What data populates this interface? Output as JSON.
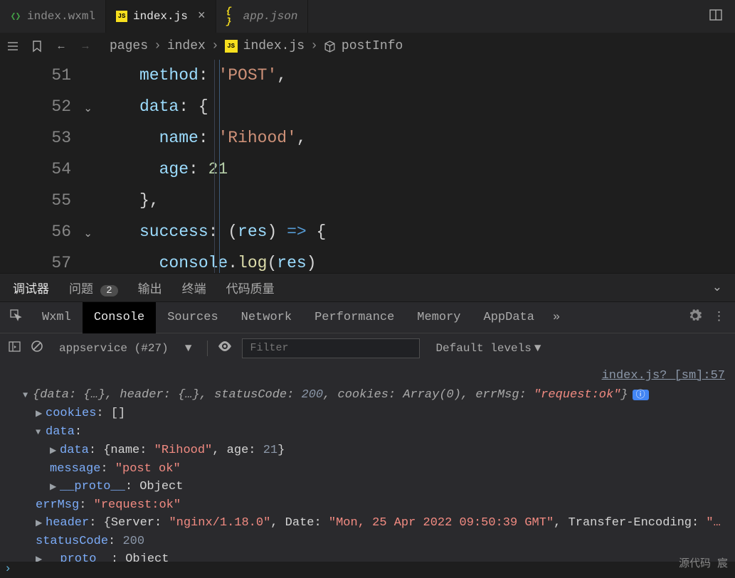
{
  "tabs": [
    {
      "label": "index.wxml",
      "type": "wxml"
    },
    {
      "label": "index.js",
      "type": "js",
      "active": true
    },
    {
      "label": "app.json",
      "type": "json"
    }
  ],
  "breadcrumb": {
    "p1": "pages",
    "p2": "index",
    "p3": "index.js",
    "p4": "postInfo"
  },
  "editor": {
    "lines": [
      {
        "n": "51",
        "t": [
          "method",
          ": ",
          "'POST'",
          ","
        ],
        "cls": [
          "prop",
          "punc",
          "str",
          "punc"
        ]
      },
      {
        "n": "52",
        "t": [
          "data",
          ": ",
          "{"
        ],
        "cls": [
          "prop",
          "punc",
          "punc"
        ],
        "fold": true
      },
      {
        "n": "53",
        "t": [
          "  name",
          ": ",
          "'Rihood'",
          ","
        ],
        "cls": [
          "prop",
          "punc",
          "str",
          "punc"
        ]
      },
      {
        "n": "54",
        "t": [
          "  age",
          ": ",
          "21"
        ],
        "cls": [
          "prop",
          "punc",
          "num"
        ]
      },
      {
        "n": "55",
        "t": [
          "}",
          ","
        ],
        "cls": [
          "punc",
          "punc"
        ]
      },
      {
        "n": "56",
        "t": [
          "success",
          ": ",
          "(",
          "res",
          ")",
          " => ",
          "{"
        ],
        "cls": [
          "prop",
          "punc",
          "punc",
          "var",
          "punc",
          "kw",
          "punc"
        ],
        "fold": true
      },
      {
        "n": "57",
        "t": [
          "  console",
          ".",
          "log",
          "(",
          "res",
          ")"
        ],
        "cls": [
          "var",
          "punc",
          "fn",
          "punc",
          "var",
          "punc"
        ]
      }
    ]
  },
  "panelTabs": {
    "debugger": "调试器",
    "problems": "问题",
    "problemsCount": "2",
    "output": "输出",
    "terminal": "终端",
    "quality": "代码质量"
  },
  "devTabs": [
    "Wxml",
    "Console",
    "Sources",
    "Network",
    "Performance",
    "Memory",
    "AppData"
  ],
  "filter": {
    "context": "appservice (#27)",
    "placeholder": "Filter",
    "levels": "Default levels"
  },
  "console": {
    "source": "index.js? [sm]:57",
    "summary": {
      "data": "{…}",
      "header": "{…}",
      "statusCode": "200",
      "cookies": "Array(0)",
      "errMsg": "\"request:ok\""
    },
    "cookies": "[]",
    "dataKey": "data",
    "dataInner": {
      "name": "\"Rihood\"",
      "age": "21"
    },
    "message": "\"post ok\"",
    "proto": "Object",
    "errMsg": "\"request:ok\"",
    "headerInner": {
      "Server": "\"nginx/1.18.0\"",
      "Date": "\"Mon, 25 Apr 2022 09:50:39 GMT\"",
      "TransferEnc": "\"…"
    },
    "statusCode": "200",
    "footer": "源代码  宸"
  },
  "icons": {
    "inspect": "⎆"
  }
}
